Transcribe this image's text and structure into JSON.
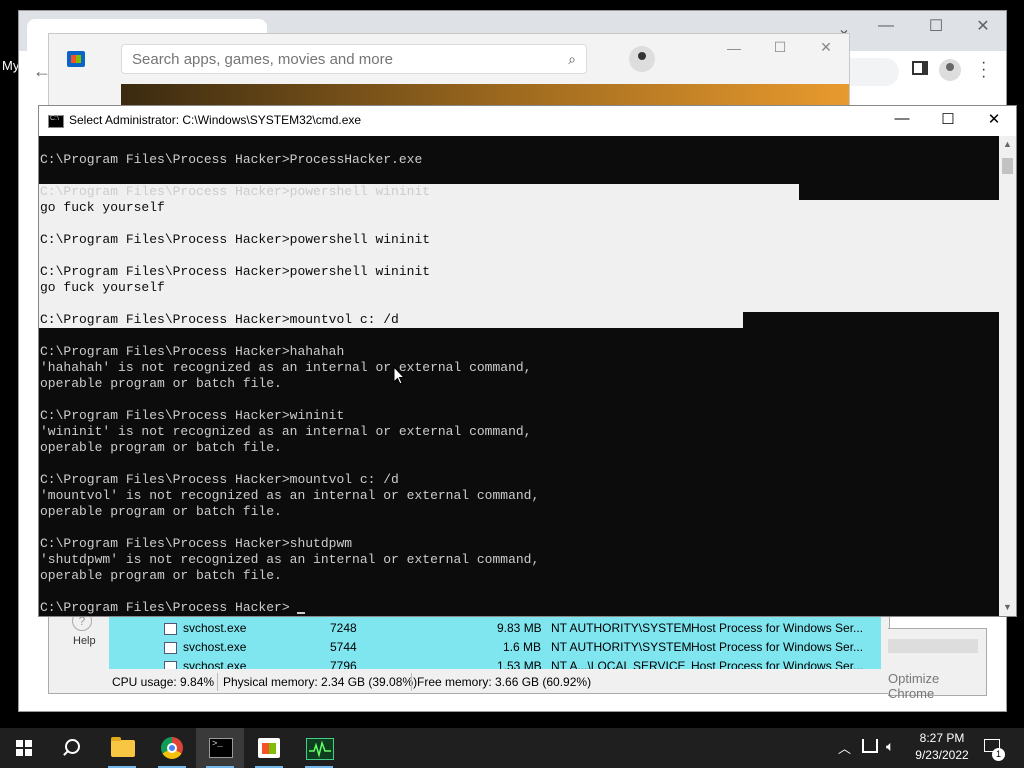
{
  "desktop": {
    "label": "My"
  },
  "store": {
    "search_placeholder": "Search apps, games, movies and more"
  },
  "cmd": {
    "title": "Select Administrator: C:\\Windows\\SYSTEM32\\cmd.exe",
    "lines": [
      "C:\\Program Files\\Process Hacker>ProcessHacker.exe",
      "",
      "C:\\Program Files\\Process Hacker>powershell wininit",
      "go fuck yourself",
      "",
      "C:\\Program Files\\Process Hacker>powershell wininit",
      "",
      "C:\\Program Files\\Process Hacker>powershell wininit",
      "go fuck yourself",
      "",
      "C:\\Program Files\\Process Hacker>mountvol c: /d",
      "",
      "C:\\Program Files\\Process Hacker>hahahah",
      "'hahahah' is not recognized as an internal or external command,",
      "operable program or batch file.",
      "",
      "C:\\Program Files\\Process Hacker>wininit",
      "'wininit' is not recognized as an internal or external command,",
      "operable program or batch file.",
      "",
      "C:\\Program Files\\Process Hacker>mountvol c: /d",
      "'mountvol' is not recognized as an internal or external command,",
      "operable program or batch file.",
      "",
      "C:\\Program Files\\Process Hacker>shutdpwm",
      "'shutdpwm' is not recognized as an internal or external command,",
      "operable program or batch file.",
      "",
      "C:\\Program Files\\Process Hacker>"
    ]
  },
  "process_hacker": {
    "help_label": "Help",
    "rows": [
      {
        "name": "svchost.exe",
        "pid": "7248",
        "memory": "9.83 MB",
        "user": "NT AUTHORITY\\SYSTEM",
        "description": "Host Process for Windows Ser..."
      },
      {
        "name": "svchost.exe",
        "pid": "5744",
        "memory": "1.6 MB",
        "user": "NT AUTHORITY\\SYSTEM",
        "description": "Host Process for Windows Ser..."
      },
      {
        "name": "svchost.exe",
        "pid": "7796",
        "memory": "1.53 MB",
        "user": "NT A...\\LOCAL SERVICE",
        "description": "Host Process for Windows Ser..."
      }
    ],
    "status": {
      "cpu": "CPU usage: 9.84%",
      "physical": "Physical memory: 2.34 GB (39.08%)",
      "free": "Free memory: 3.66 GB (60.92%)"
    },
    "right_text": "Optimize Chrome"
  },
  "taskbar": {
    "time": "8:27 PM",
    "date": "9/23/2022",
    "notification_count": "1",
    "pinned": [
      "start-icon",
      "search-icon",
      "file-explorer-icon",
      "chrome-icon",
      "command-prompt-icon",
      "microsoft-store-icon",
      "process-hacker-icon"
    ]
  }
}
